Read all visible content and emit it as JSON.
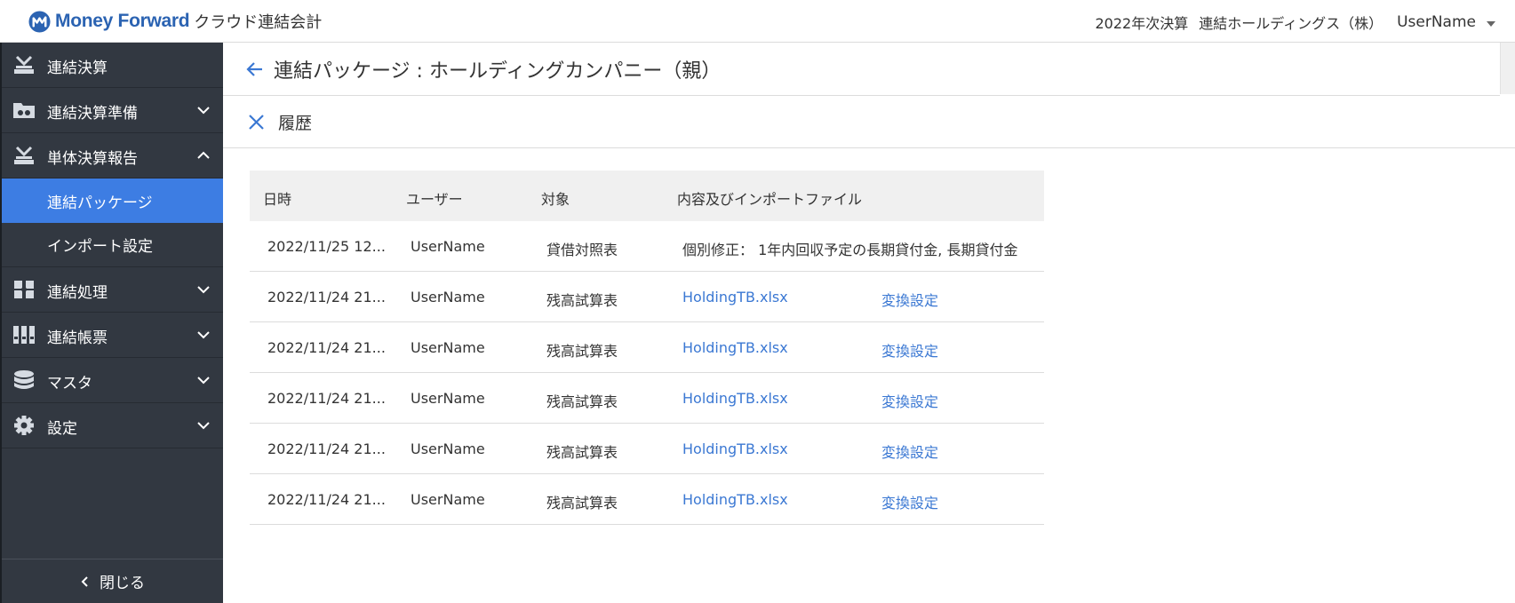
{
  "header": {
    "logo_text": "Money Forward",
    "logo_sub": "クラウド連結会計",
    "fiscal_period": "2022年次決算",
    "company": "連結ホールディングス（株）",
    "user_name": "UserName"
  },
  "sidebar": {
    "items": [
      {
        "label": "連結決算",
        "icon": "consolidation-icon"
      },
      {
        "label": "連結決算準備",
        "icon": "preparation-icon",
        "expanded": false
      },
      {
        "label": "単体決算報告",
        "icon": "report-icon",
        "expanded": true,
        "children": [
          {
            "label": "連結パッケージ",
            "active": true
          },
          {
            "label": "インポート設定",
            "active": false
          }
        ]
      },
      {
        "label": "連結処理",
        "icon": "processing-icon",
        "expanded": false
      },
      {
        "label": "連結帳票",
        "icon": "ledger-icon",
        "expanded": false
      },
      {
        "label": "マスタ",
        "icon": "database-icon",
        "expanded": false
      },
      {
        "label": "設定",
        "icon": "gear-icon",
        "expanded": false
      }
    ],
    "close_label": "閉じる"
  },
  "main": {
    "title": "連結パッケージ : ホールディングカンパニー（親）",
    "history_title": "履歴"
  },
  "table": {
    "columns": [
      "日時",
      "ユーザー",
      "対象",
      "内容及びインポートファイル"
    ],
    "rows": [
      {
        "datetime": "2022/11/25 12...",
        "user": "UserName",
        "target": "貸借対照表",
        "content": "個別修正： 1年内回収予定の長期貸付金, 長期貸付金",
        "setting": ""
      },
      {
        "datetime": "2022/11/24 21...",
        "user": "UserName",
        "target": "残高試算表",
        "content": "HoldingTB.xlsx",
        "setting": "変換設定"
      },
      {
        "datetime": "2022/11/24 21...",
        "user": "UserName",
        "target": "残高試算表",
        "content": "HoldingTB.xlsx",
        "setting": "変換設定"
      },
      {
        "datetime": "2022/11/24 21...",
        "user": "UserName",
        "target": "残高試算表",
        "content": "HoldingTB.xlsx",
        "setting": "変換設定"
      },
      {
        "datetime": "2022/11/24 21...",
        "user": "UserName",
        "target": "残高試算表",
        "content": "HoldingTB.xlsx",
        "setting": "変換設定"
      },
      {
        "datetime": "2022/11/24 21...",
        "user": "UserName",
        "target": "残高試算表",
        "content": "HoldingTB.xlsx",
        "setting": "変換設定"
      }
    ]
  },
  "colors": {
    "brand": "#2b63b2",
    "sidebar_bg": "#323841",
    "active": "#3d7de3",
    "link": "#3b78d3"
  }
}
